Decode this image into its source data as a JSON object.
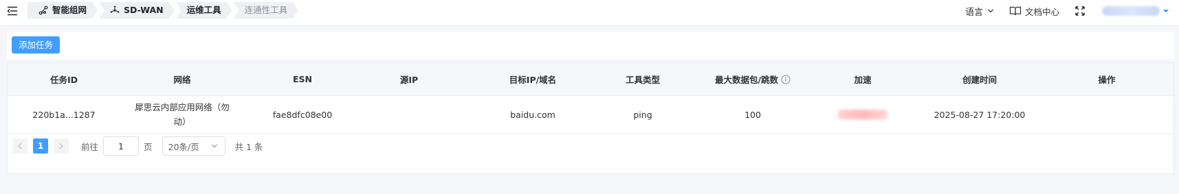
{
  "header": {
    "breadcrumbs": [
      {
        "label": "智能组网",
        "icon": "network-icon"
      },
      {
        "label": "SD-WAN",
        "icon": "sdwan-icon"
      },
      {
        "label": "运维工具"
      },
      {
        "label": "连通性工具"
      }
    ],
    "language_label": "语言",
    "docs_label": "文档中心"
  },
  "toolbar": {
    "add_task_label": "添加任务"
  },
  "table": {
    "columns": [
      "任务ID",
      "网络",
      "ESN",
      "源IP",
      "目标IP/域名",
      "工具类型",
      "最大数据包/跳数",
      "加速",
      "创建时间",
      "操作"
    ],
    "rows": [
      {
        "task_id": "220b1a...1287",
        "network_line1": "犀思云内部应用网络（勿",
        "network_line2": "动）",
        "esn": "fae8dfc08e00",
        "source_ip": "",
        "target": "baidu.com",
        "tool_type": "ping",
        "max_packets": "100",
        "created_at": "2025-08-27 17:20:00",
        "actions": ""
      }
    ]
  },
  "pagination": {
    "current_page": "1",
    "goto_prefix": "前往",
    "goto_value": "1",
    "goto_suffix": "页",
    "page_size": "20条/页",
    "total_text": "共 1 条"
  },
  "colors": {
    "primary": "#409eff",
    "header_bg": "#f5f7fa"
  }
}
